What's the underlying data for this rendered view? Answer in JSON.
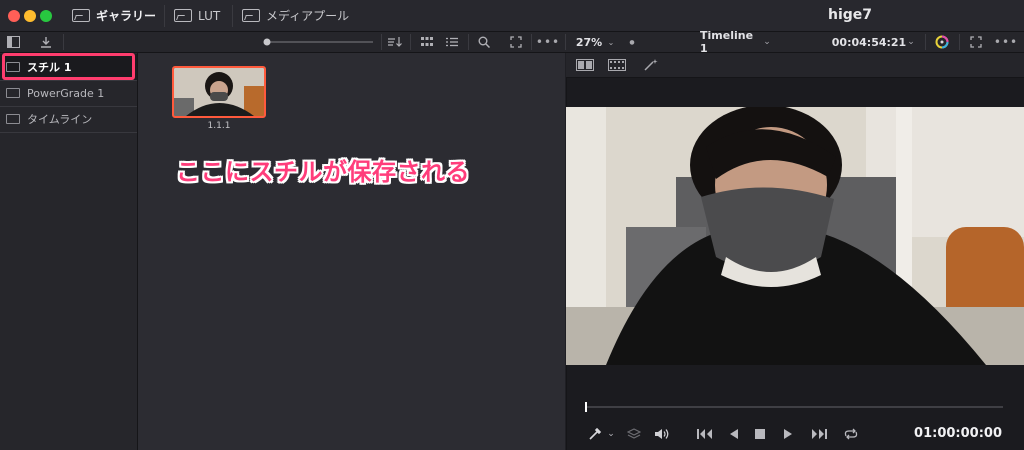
{
  "window": {
    "traffic_colors": [
      "#ff5f57",
      "#febc2e",
      "#28c840"
    ],
    "project_title": "hige7"
  },
  "tabs": [
    {
      "label": "ギャラリー",
      "icon": "gallery-icon",
      "active": true
    },
    {
      "label": "LUT",
      "icon": "lut-icon",
      "active": false
    },
    {
      "label": "メディアプール",
      "icon": "media-pool-icon",
      "active": false
    }
  ],
  "viewer_header": {
    "zoom": "27%",
    "timeline": "Timeline 1",
    "timecode": "00:04:54:21"
  },
  "albums": [
    {
      "label": "スチル 1",
      "icon": "still-album-icon",
      "selected": true
    },
    {
      "label": "PowerGrade 1",
      "icon": "powergrade-album-icon",
      "selected": false
    },
    {
      "label": "タイムライン",
      "icon": "timeline-album-icon",
      "selected": false
    }
  ],
  "still": {
    "label": "1.1.1"
  },
  "annotation": {
    "text": "ここにスチルが保存される",
    "color": "#ff3d7b"
  },
  "transport": {
    "timecode": "01:00:00:00"
  },
  "colors": {
    "highlight": "#ff3d6e",
    "still_border": "#ff5a3c"
  }
}
